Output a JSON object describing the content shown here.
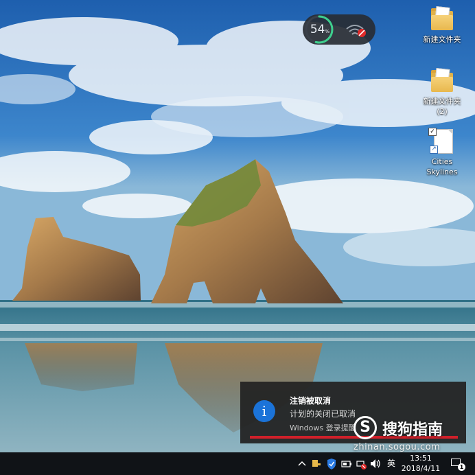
{
  "desktop": {
    "icons": [
      {
        "label": "新建文件夹",
        "icon": "folder-icon"
      },
      {
        "label": "新建文件夹 (2)",
        "icon": "folder-icon"
      },
      {
        "label": "Cities Skylines",
        "icon": "document-shortcut-icon"
      }
    ]
  },
  "widget": {
    "percent": "54",
    "percent_unit": "%",
    "network_icon": "wifi-disconnected-icon",
    "accent": "#3ecf8e"
  },
  "toast": {
    "title": "注销被取消",
    "body": "计划的关闭已取消",
    "source": "Windows 登录提醒",
    "icon": "info-icon",
    "accent": "#d0202a",
    "icon_color": "#1b73d8"
  },
  "watermark": {
    "logo": "S",
    "name": "搜狗指南",
    "url": "zhinan.sogou.com"
  },
  "taskbar": {
    "tray_icons": [
      "chevron-up-icon",
      "security-key-icon",
      "shield-icon",
      "battery-icon",
      "network-error-icon",
      "volume-icon"
    ],
    "ime": "英",
    "time": "13:51",
    "date": "2018/4/11",
    "notification_count": "1"
  }
}
